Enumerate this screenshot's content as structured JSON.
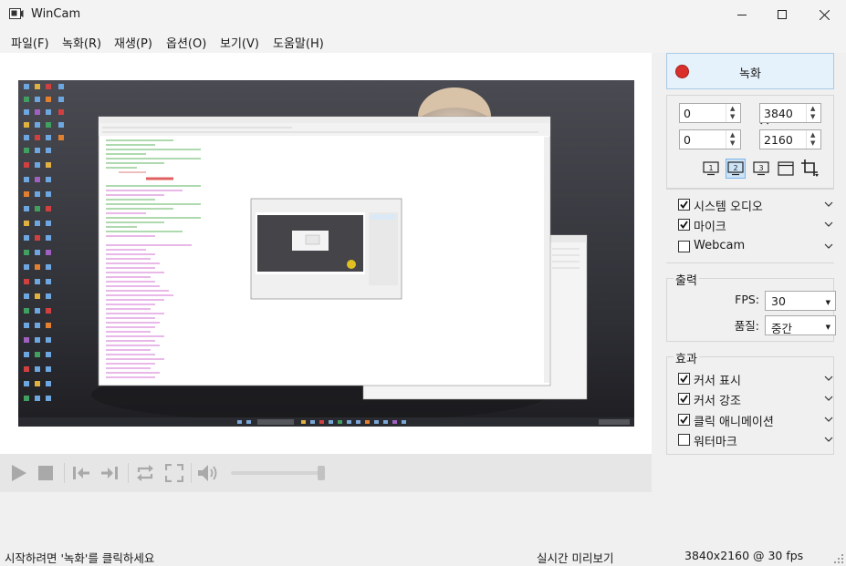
{
  "window": {
    "title": "WinCam"
  },
  "menu": [
    "파일(F)",
    "녹화(R)",
    "재생(P)",
    "옵션(O)",
    "보기(V)",
    "도움말(H)"
  ],
  "record": {
    "label": "녹화"
  },
  "region": {
    "x": "0",
    "y": "0",
    "width": "3840",
    "height": "2160"
  },
  "capture_toolbar": {
    "monitor_buttons": [
      "1",
      "2",
      "3"
    ],
    "selected_monitor": "2",
    "icons": [
      "monitor-1-icon",
      "monitor-2-icon",
      "monitor-3-icon",
      "window-capture-icon",
      "crop-region-icon"
    ]
  },
  "audio": [
    {
      "label": "시스템 오디오",
      "checked": true
    },
    {
      "label": "마이크",
      "checked": true
    },
    {
      "label": "Webcam",
      "checked": false
    }
  ],
  "output": {
    "title": "출력",
    "fps_label": "FPS:",
    "fps_value": "30",
    "quality_label": "품질:",
    "quality_value": "중간"
  },
  "effects": {
    "title": "효과",
    "items": [
      {
        "label": "커서 표시",
        "checked": true
      },
      {
        "label": "커서 강조",
        "checked": true
      },
      {
        "label": "클릭 애니메이션",
        "checked": true
      },
      {
        "label": "워터마크",
        "checked": false
      }
    ]
  },
  "status": {
    "hint": "시작하려면 '녹화'를 클릭하세요",
    "mode": "실시간 미리보기",
    "info": "3840x2160 @ 30 fps"
  },
  "colors": {
    "record_red": "#d9302c",
    "accent_blue": "#0a64c8"
  }
}
